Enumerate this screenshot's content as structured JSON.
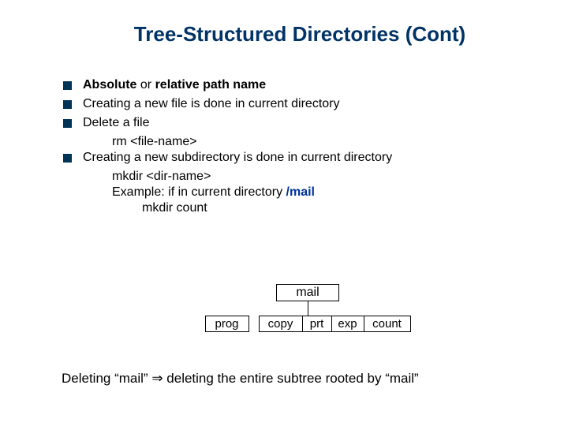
{
  "title": "Tree-Structured Directories (Cont)",
  "b1_a": "Absolute",
  "b1_b": " or ",
  "b1_c": "relative",
  "b1_d": " path name",
  "b2": "Creating a new file is done in current directory",
  "b3": "Delete a file",
  "b3_sub": "rm <file-name>",
  "b4": "Creating a new subdirectory is done in current directory",
  "b4_sub1": "mkdir <dir-name>",
  "b4_ex_a": "Example:  if in current directory   ",
  "b4_ex_b": "/mail",
  "b4_sub2": "mkdir count",
  "node_mail": "mail",
  "c_prog": "prog",
  "c_copy": "copy",
  "c_prt": "prt",
  "c_exp": "exp",
  "c_count": "count",
  "footer_a": "Deleting “mail” ",
  "footer_arrow": "⇒",
  "footer_b": " deleting the entire subtree rooted by “mail”"
}
